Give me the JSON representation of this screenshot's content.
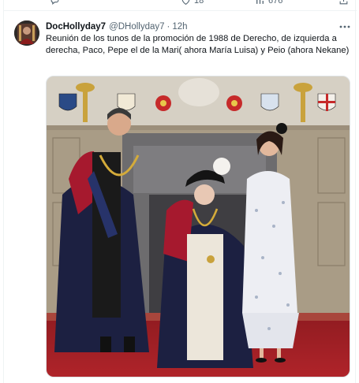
{
  "tweet": {
    "display_name": "DocHollyday7",
    "handle": "@DHollyday7",
    "separator": "·",
    "time": "12h",
    "text": "Reunión de los tunos de la promoción de 1988 de Derecho, de izquierda a derecha, Paco, Pepe el de la Mari( ahora María Luisa) y Peio (ahora Nekane)"
  },
  "previous_tweet_actions": {
    "likes": "18",
    "views": "676"
  },
  "icons": {
    "more": "more-horizontal-icon",
    "reply": "reply-icon",
    "like": "heart-icon",
    "views": "bar-chart-icon",
    "share": "share-icon"
  },
  "colors": {
    "text": "#0f1419",
    "secondary": "#536471",
    "border": "#eff3f4",
    "carpet": "#9e1d22",
    "robe": "#1a1e3a",
    "mantle_red": "#a6192e"
  }
}
